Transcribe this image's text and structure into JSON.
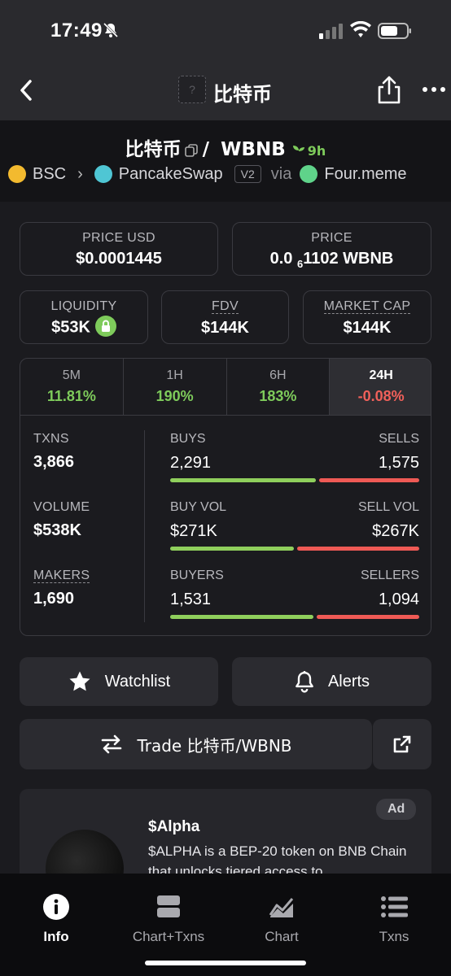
{
  "status": {
    "time": "17:49"
  },
  "nav": {
    "title": "比特币",
    "token_placeholder": "?"
  },
  "pair": {
    "base": "比特币",
    "slash": "/",
    "quote": "WBNB",
    "age": "9h"
  },
  "route": {
    "chain": "BSC",
    "dex": "PancakeSwap",
    "version": "V2",
    "via": "via",
    "launchpad": "Four.meme"
  },
  "cards": {
    "price_usd": {
      "label": "PRICE USD",
      "value": "$0.0001445"
    },
    "price": {
      "label": "PRICE",
      "value_prefix": "0.0",
      "value_sub": "6",
      "value_rest": "1102 WBNB"
    },
    "liquidity": {
      "label": "LIQUIDITY",
      "value": "$53K"
    },
    "fdv": {
      "label": "FDV",
      "value": "$144K"
    },
    "market_cap": {
      "label": "MARKET CAP",
      "value": "$144K"
    }
  },
  "tabs": [
    {
      "label": "5M",
      "value": "11.81%"
    },
    {
      "label": "1H",
      "value": "190%"
    },
    {
      "label": "6H",
      "value": "183%"
    },
    {
      "label": "24H",
      "value": "-0.08%"
    }
  ],
  "metrics": {
    "txns": {
      "label": "TXNS",
      "value": "3,866"
    },
    "volume": {
      "label": "VOLUME",
      "value": "$538K"
    },
    "makers": {
      "label": "MAKERS",
      "value": "1,690"
    }
  },
  "bars": {
    "txns": {
      "left_label": "BUYS",
      "right_label": "SELLS",
      "left_value": "2,291",
      "right_value": "1,575",
      "buy_fraction": 0.593
    },
    "volume": {
      "left_label": "BUY VOL",
      "right_label": "SELL VOL",
      "left_value": "$271K",
      "right_value": "$267K",
      "buy_fraction": 0.504
    },
    "makers": {
      "left_label": "BUYERS",
      "right_label": "SELLERS",
      "left_value": "1,531",
      "right_value": "1,094",
      "buy_fraction": 0.583
    }
  },
  "buttons": {
    "watchlist": "Watchlist",
    "alerts": "Alerts",
    "trade": "Trade 比特币/WBNB"
  },
  "ad": {
    "badge": "Ad",
    "title": "$Alpha",
    "text": "$ALPHA is a BEP-20 token on BNB Chain that unlocks tiered access to"
  },
  "bottom_tabs": [
    {
      "label": "Info",
      "icon": "info-icon"
    },
    {
      "label": "Chart+Txns",
      "icon": "split-view-icon"
    },
    {
      "label": "Chart",
      "icon": "chart-icon"
    },
    {
      "label": "Txns",
      "icon": "list-icon"
    }
  ],
  "colors": {
    "positive": "#7ecb5b",
    "negative": "#f0605a",
    "buy_bar": "#8fcf5c",
    "sell_bar": "#ef5a55"
  }
}
